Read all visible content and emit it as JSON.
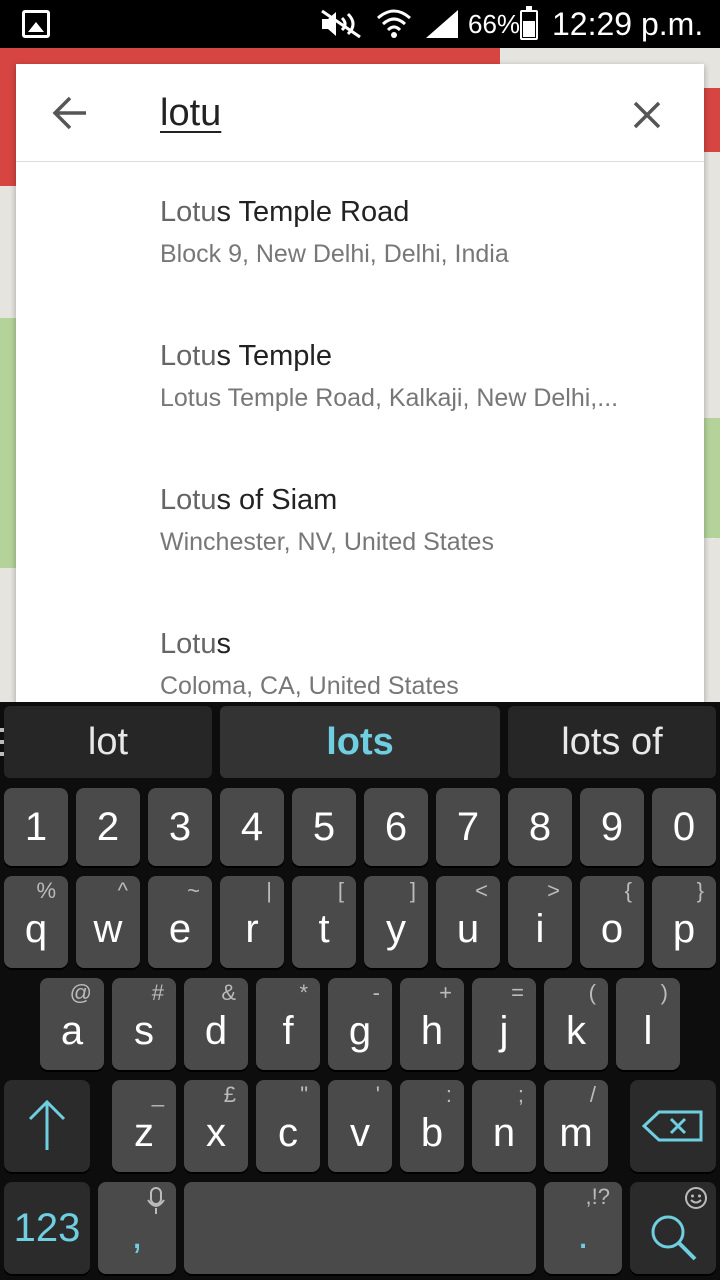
{
  "status_bar": {
    "battery_percent": "66%",
    "time": "12:29 p.m."
  },
  "map": {
    "colors": {
      "background": "#e6e4df",
      "red_bar": "#d64541",
      "green": "#b4d39a"
    }
  },
  "search": {
    "query": "lotu",
    "back_icon": "arrow-left-icon",
    "clear_icon": "close-icon"
  },
  "results": [
    {
      "title_match": "Lotu",
      "title_rest": "s Temple Road",
      "subtitle": "Block 9, New Delhi, Delhi, India"
    },
    {
      "title_match": "Lotu",
      "title_rest": "s Temple",
      "subtitle": "Lotus Temple Road, Kalkaji, New Delhi,..."
    },
    {
      "title_match": "Lotu",
      "title_rest": "s of Siam",
      "subtitle": "Winchester, NV, United States"
    },
    {
      "title_match": "Lotu",
      "title_rest": "s",
      "subtitle": "Coloma, CA, United States"
    }
  ],
  "keyboard": {
    "suggestions": [
      "lot",
      "lots",
      "lots of"
    ],
    "number_row": [
      "1",
      "2",
      "3",
      "4",
      "5",
      "6",
      "7",
      "8",
      "9",
      "0"
    ],
    "row1": [
      {
        "key": "q",
        "hint": "%"
      },
      {
        "key": "w",
        "hint": "^"
      },
      {
        "key": "e",
        "hint": "~"
      },
      {
        "key": "r",
        "hint": "|"
      },
      {
        "key": "t",
        "hint": "["
      },
      {
        "key": "y",
        "hint": "]"
      },
      {
        "key": "u",
        "hint": "<"
      },
      {
        "key": "i",
        "hint": ">"
      },
      {
        "key": "o",
        "hint": "{"
      },
      {
        "key": "p",
        "hint": "}"
      }
    ],
    "row2": [
      {
        "key": "a",
        "hint": "@"
      },
      {
        "key": "s",
        "hint": "#"
      },
      {
        "key": "d",
        "hint": "&"
      },
      {
        "key": "f",
        "hint": "*"
      },
      {
        "key": "g",
        "hint": "-"
      },
      {
        "key": "h",
        "hint": "+"
      },
      {
        "key": "j",
        "hint": "="
      },
      {
        "key": "k",
        "hint": "("
      },
      {
        "key": "l",
        "hint": ")"
      }
    ],
    "row3": [
      {
        "key": "z",
        "hint": "_"
      },
      {
        "key": "x",
        "hint": "£"
      },
      {
        "key": "c",
        "hint": "\""
      },
      {
        "key": "v",
        "hint": "'"
      },
      {
        "key": "b",
        "hint": ":"
      },
      {
        "key": "n",
        "hint": ";"
      },
      {
        "key": "m",
        "hint": "/"
      }
    ],
    "symbols_label": "123",
    "comma_label": ",",
    "period_label": ".",
    "period_hint": ",!?",
    "accent_color": "#6fcfe0"
  }
}
